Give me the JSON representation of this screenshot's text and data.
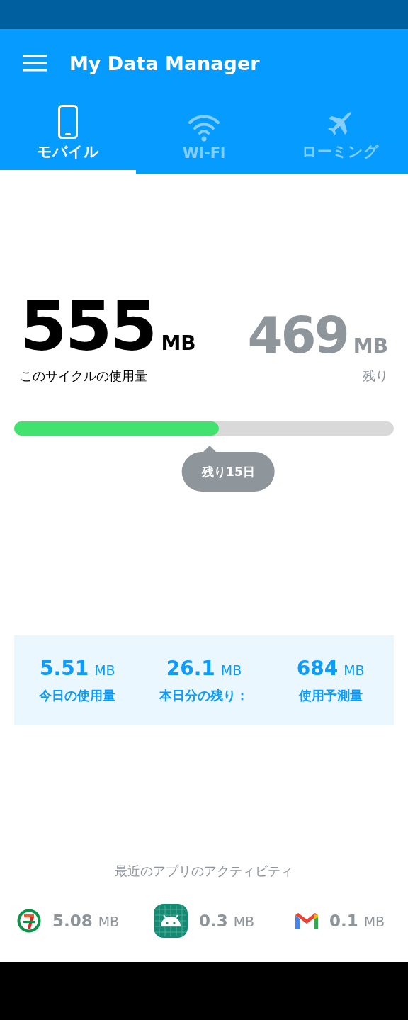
{
  "app_bar": {
    "title": "My Data Manager"
  },
  "tabs": [
    {
      "label": "モバイル",
      "kind": "phone",
      "selected": true
    },
    {
      "label": "Wi-Fi",
      "kind": "wifi",
      "selected": false
    },
    {
      "label": "ローミング",
      "kind": "plane",
      "selected": false
    }
  ],
  "usage": {
    "used": {
      "value": "555",
      "unit": "MB",
      "label": "このサイクルの使用量"
    },
    "remaining": {
      "value": "469",
      "unit": "MB",
      "label": "残り"
    }
  },
  "cycle": {
    "level": 0.54,
    "days_left": "残り15日"
  },
  "stats": [
    {
      "value": "5.51",
      "unit": "MB",
      "label": "今日の使用量"
    },
    {
      "value": "26.1",
      "unit": "MB",
      "label": "本日分の残り："
    },
    {
      "value": "684",
      "unit": "MB",
      "label": "使用予測量"
    }
  ],
  "recent_activity": {
    "title": "最近のアプリのアクティビティ",
    "apps": [
      {
        "kind": "store",
        "value": "5.08",
        "unit": "MB"
      },
      {
        "kind": "android",
        "value": "0.3",
        "unit": "MB"
      },
      {
        "kind": "mail",
        "value": "0.1",
        "unit": "MB"
      }
    ]
  }
}
